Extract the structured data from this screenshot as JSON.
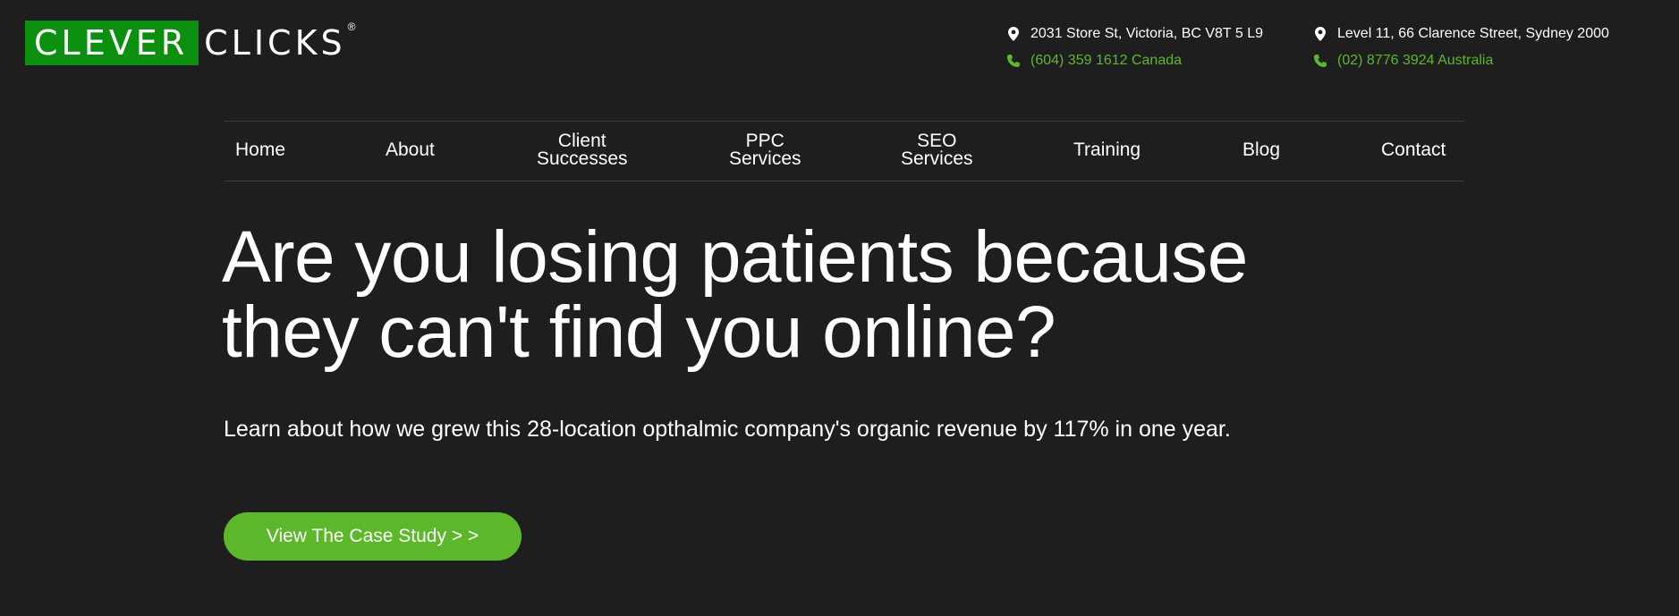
{
  "brand": {
    "word1": "CLEVER",
    "word2": "CLICKS",
    "reg": "®",
    "green": "#0a8f0e"
  },
  "contacts": [
    {
      "address": "2031 Store St, Victoria, BC V8T 5 L9",
      "phone": "(604) 359 1612 Canada"
    },
    {
      "address": "Level 11, 66 Clarence Street, Sydney 2000",
      "phone": "(02) 8776 3924 Australia"
    }
  ],
  "icons": {
    "address": "map-pin-icon",
    "phone": "phone-icon"
  },
  "nav": [
    {
      "label": "Home"
    },
    {
      "label": "About"
    },
    {
      "label_line1": "Client",
      "label_line2": "Successes"
    },
    {
      "label_line1": "PPC",
      "label_line2": "Services"
    },
    {
      "label_line1": "SEO",
      "label_line2": "Services"
    },
    {
      "label": "Training"
    },
    {
      "label": "Blog"
    },
    {
      "label": "Contact"
    }
  ],
  "hero": {
    "headline_line1": "Are you losing patients because",
    "headline_line2": "they can't find you online?",
    "subtext": "Learn about how we grew this 28-location opthalmic company's organic revenue by 117% in one year.",
    "cta": "View The Case Study > >"
  },
  "colors": {
    "background": "#1e1e1f",
    "accent": "#5cb82a",
    "text": "#ffffff"
  }
}
